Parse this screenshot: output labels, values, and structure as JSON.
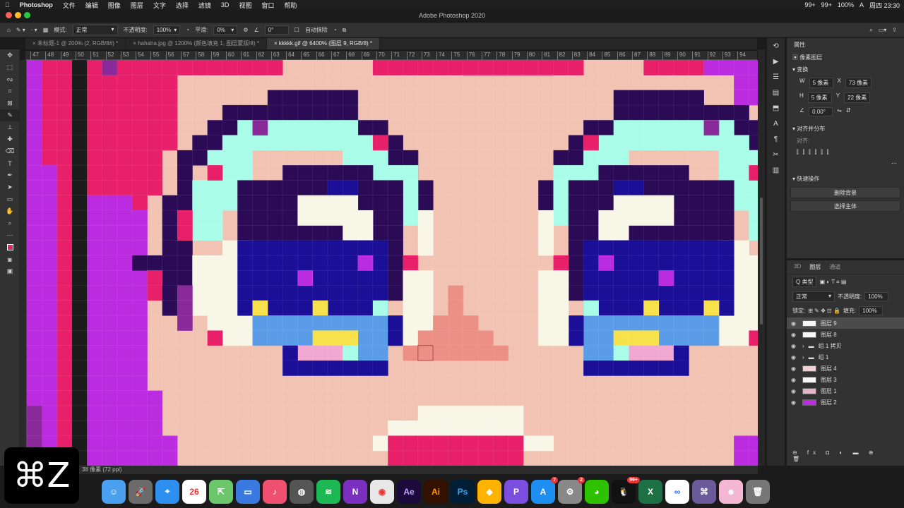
{
  "menubar": {
    "apple": "",
    "items": [
      "Photoshop",
      "文件",
      "编辑",
      "图像",
      "图层",
      "文字",
      "选择",
      "滤镜",
      "3D",
      "视图",
      "窗口",
      "帮助"
    ],
    "status": [
      "99+",
      "99+",
      "100%",
      "A",
      "周四 23:30"
    ]
  },
  "window_title": "Adobe Photoshop 2020",
  "options": {
    "mode_label": "模式:",
    "mode_value": "正常",
    "opacity_label": "不透明度:",
    "opacity_value": "100%",
    "smooth_label": "平滑:",
    "smooth_value": "0%",
    "angle_value": "0°",
    "auto_erase": "自动抹除"
  },
  "tabs": [
    "未标题-1 @ 200% (2, RGB/8#) *",
    "hahaha.jpg @ 1200% (颜色填充 1, 图层蒙版/8) *",
    "kkkkk.gif @ 6400% (图层 9, RGB/8) *"
  ],
  "ruler_top": [
    "47",
    "48",
    "49",
    "50",
    "51",
    "52",
    "53",
    "54",
    "55",
    "56",
    "57",
    "58",
    "59",
    "60",
    "61",
    "62",
    "63",
    "64",
    "65",
    "66",
    "67",
    "68",
    "69",
    "70",
    "71",
    "72",
    "73",
    "74",
    "75",
    "76",
    "77",
    "78",
    "79",
    "80",
    "81",
    "82",
    "83",
    "84",
    "85",
    "86",
    "87",
    "88",
    "89",
    "90",
    "91",
    "92",
    "93",
    "94"
  ],
  "statusbar": "38 像素 (72 ppi)",
  "properties": {
    "title": "属性",
    "layer_type": "像素图层",
    "transform": "变换",
    "w": "5 像素",
    "h": "5 像素",
    "x": "73 像素",
    "y": "22 像素",
    "angle": "0.00°",
    "align": "对齐并分布",
    "align_sub": "对齐:",
    "quick": "快速操作",
    "btn_remove_bg": "删除背景",
    "btn_select_subject": "选择主体"
  },
  "layers_panel": {
    "tabs": [
      "3D",
      "图层",
      "通道"
    ],
    "kind": "Q 类型",
    "blend": "正常",
    "opacity_label": "不透明度:",
    "opacity": "100%",
    "lock_label": "锁定:",
    "fill_label": "填充:",
    "fill": "100%",
    "layers": [
      "图层 9",
      "图层 8",
      "组 1 拷贝",
      "组 1",
      "图层 4",
      "图层 3",
      "图层 1",
      "图层 2"
    ]
  },
  "undo_overlay": "⌘Z",
  "dock": [
    "Finder",
    "Launchpad",
    "Safari",
    "Calendar",
    "Maps",
    "Keynote",
    "Music",
    "Photo Booth",
    "Spotify",
    "OneNote",
    "Chrome",
    "Ae",
    "Ai",
    "Ps",
    "Sketch",
    "PicGo",
    "App Store",
    "System Preferences",
    "WeChat",
    "QQ",
    "Excel",
    "Baidu",
    "Sketchbook",
    "Avatar",
    "Trash"
  ],
  "dock_calendar_day": "26",
  "badges": {
    "appstore": "7",
    "sysprefs": "2",
    "qq": "99+"
  },
  "colors": {
    "bg_skin": "#f2c3b2",
    "hot_pink": "#e8206a",
    "purple": "#bb2be0",
    "dark_navy": "#2b0b55",
    "mint": "#a8fce8",
    "blue": "#1a0f96",
    "light_blue": "#5a9ce8",
    "cream": "#f8f6e6",
    "yellow": "#f7e24c",
    "nose": "#ec8f85"
  }
}
